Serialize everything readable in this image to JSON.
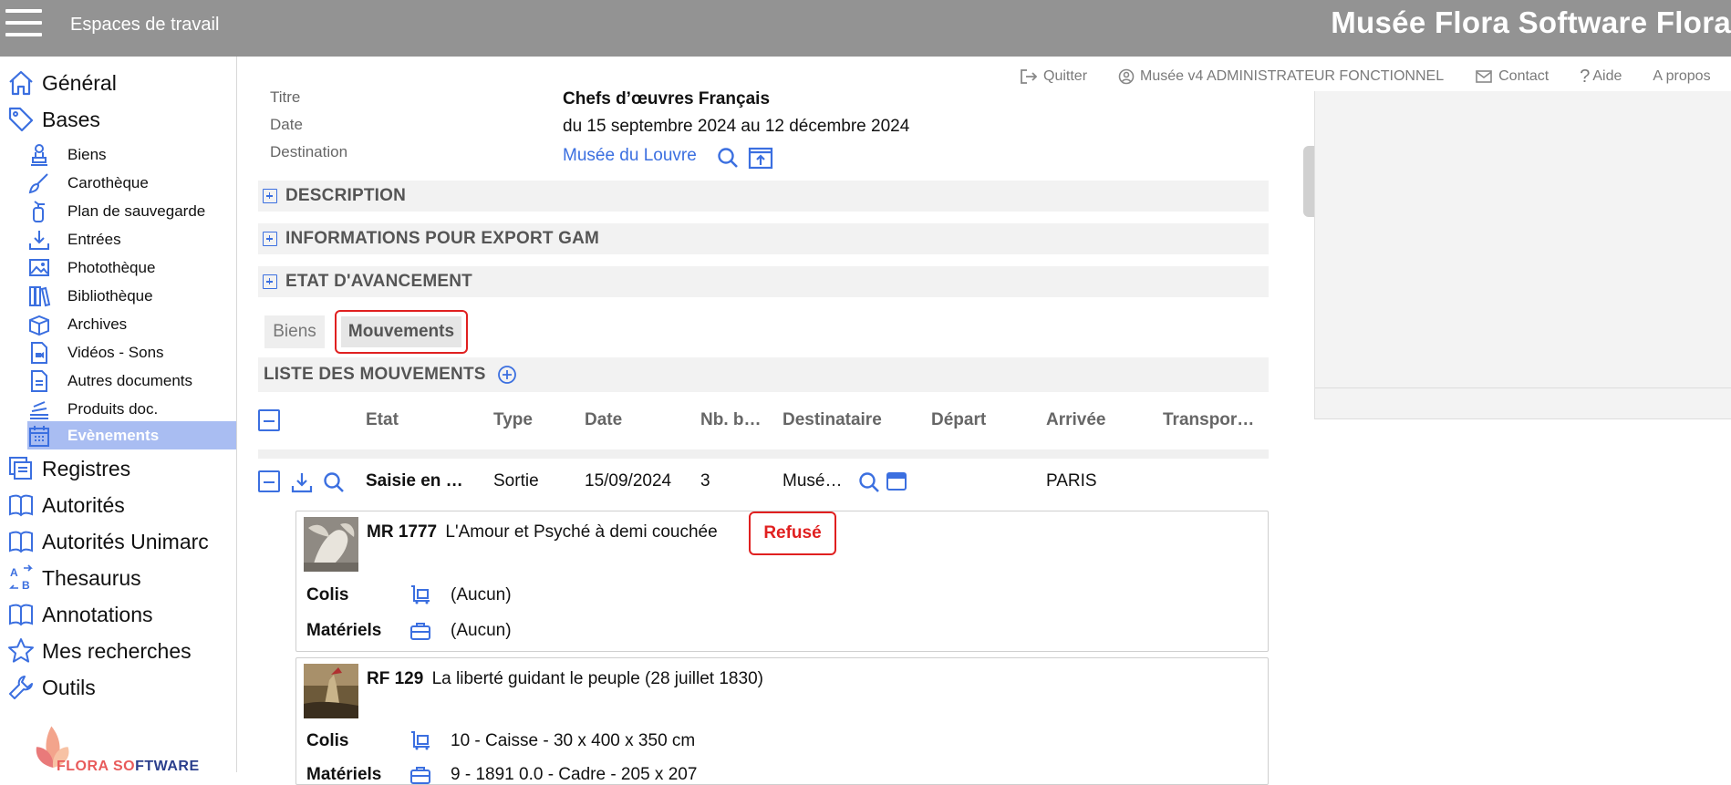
{
  "header": {
    "workspaces_label": "Espaces de travail",
    "app_title": "Musée Flora Software Flora"
  },
  "toplinks": {
    "quit": "Quitter",
    "user": "Musée v4 ADMINISTRATEUR FONCTIONNEL",
    "contact": "Contact",
    "help": "Aide",
    "about": "A propos"
  },
  "sidebar": {
    "general": "Général",
    "bases": "Bases",
    "sub": [
      "Biens",
      "Carothèque",
      "Plan de sauvegarde",
      "Entrées",
      "Photothèque",
      "Bibliothèque",
      "Archives",
      "Vidéos - Sons",
      "Autres documents",
      "Produits doc.",
      "Evènements"
    ],
    "registres": "Registres",
    "autorites": "Autorités",
    "autorites_unimarc": "Autorités Unimarc",
    "thesaurus": "Thesaurus",
    "annotations": "Annotations",
    "mes_recherches": "Mes recherches",
    "outils": "Outils",
    "logo_text": "FLORA SOFTWARE"
  },
  "record": {
    "titre_label": "Titre",
    "titre_value": "Chefs d’œuvres Français",
    "date_label": "Date",
    "date_value": "du 15 septembre 2024 au 12 décembre 2024",
    "destination_label": "Destination",
    "destination_value": "Musée du Louvre"
  },
  "sections": {
    "description": "DESCRIPTION",
    "export_gam": "INFORMATIONS POUR EXPORT GAM",
    "avancement": "ETAT D'AVANCEMENT"
  },
  "tabs": {
    "biens": "Biens",
    "mouvements": "Mouvements"
  },
  "list": {
    "title": "LISTE DES MOUVEMENTS",
    "columns": {
      "etat": "Etat",
      "type": "Type",
      "date": "Date",
      "nb": "Nb. b…",
      "destinataire": "Destinataire",
      "depart": "Départ",
      "arrivee": "Arrivée",
      "transport": "Transpor…"
    },
    "row": {
      "etat": "Saisie en …",
      "type": "Sortie",
      "date": "15/09/2024",
      "nb": "3",
      "destinataire": "Musé…",
      "arrivee": "PARIS"
    }
  },
  "items": [
    {
      "ref": "MR 1777",
      "title": "L'Amour et Psyché à demi couchée",
      "status": "Refusé",
      "colis_label": "Colis",
      "colis_value": "(Aucun)",
      "materiels_label": "Matériels",
      "materiels_value": "(Aucun)"
    },
    {
      "ref": "RF 129",
      "title": "La liberté guidant le peuple (28 juillet 1830)",
      "colis_label": "Colis",
      "colis_value": "10 - Caisse - 30 x 400 x 350 cm",
      "materiels_label": "Matériels",
      "materiels_value": "9 - 1891 0.0 - Cadre - 205 x 207"
    }
  ],
  "colors": {
    "accent": "#3b6fe0",
    "header_bg": "#939393",
    "highlight_red": "#e02020",
    "active_nav": "#a9bdf2"
  }
}
